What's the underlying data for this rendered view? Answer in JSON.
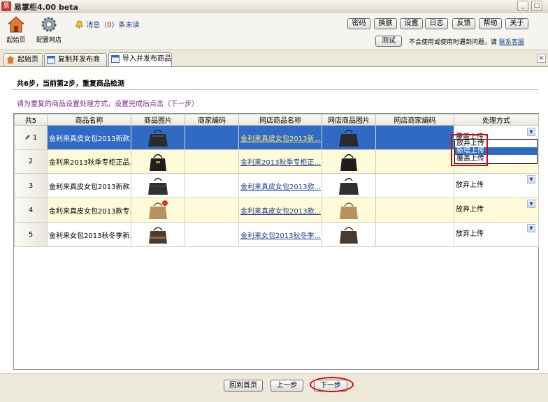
{
  "window": {
    "title": "易掌柜4.00 beta",
    "app_icon": "易"
  },
  "toolbar": {
    "home_label": "起始页",
    "config_label": "配置网店",
    "msg_prefix": "消息（",
    "msg_count": "0",
    "msg_suffix": "）条未读",
    "buttons": [
      "密码",
      "换肤",
      "设置",
      "日志",
      "反馈",
      "帮助",
      "关于"
    ],
    "test_label": "测试",
    "hint_text": "不会使用或使用时遇到问题，请",
    "hint_link": "联系客服"
  },
  "tabs": [
    {
      "label": "起始页"
    },
    {
      "label": "复制并发布商品"
    },
    {
      "label": "导入并发布商品"
    }
  ],
  "step": {
    "title": "共6步，当前第2步，重复商品检测",
    "instruction": "请为重复的商品设置处理方式，设置完成后点击（下一步）"
  },
  "table": {
    "columns": [
      "共5",
      "商品名称",
      "商品图片",
      "商家编码",
      "网店商品名称",
      "网店商品图片",
      "网店商家编码",
      "处理方式"
    ],
    "rows": [
      {
        "num": "1",
        "name": "金利来真皮女包2013新款...",
        "code": "",
        "shop_name": "金利来真皮女包2013新...",
        "shop_code": "",
        "action": "覆盖上传"
      },
      {
        "num": "2",
        "name": "金利来2013秋季专柜正品...",
        "code": "",
        "shop_name": "金利来2013秋季专柜正...",
        "shop_code": "",
        "action": ""
      },
      {
        "num": "3",
        "name": "金利来真皮女包2013新款...",
        "code": "",
        "shop_name": "金利来真皮女包2013款...",
        "shop_code": "",
        "action": "放弃上传"
      },
      {
        "num": "4",
        "name": "金利来真皮女包2013款专...",
        "code": "",
        "shop_name": "金利来真皮女包2013款...",
        "shop_code": "",
        "action": "放弃上传"
      },
      {
        "num": "5",
        "name": "金利来女包2013秋冬季新...",
        "code": "",
        "shop_name": "金利来女包2013秋冬季...",
        "shop_code": "",
        "action": "放弃上传"
      }
    ],
    "dropdown_options": [
      "放弃上传",
      "新增上传",
      "覆盖上传"
    ],
    "dropdown_highlighted": "新增上传"
  },
  "footer": {
    "home": "回到首页",
    "prev": "上一步",
    "next": "下一步"
  },
  "colors": {
    "selection": "#316ac5",
    "highlight_red": "#d20a0a",
    "alt_row": "#fffbd9"
  }
}
